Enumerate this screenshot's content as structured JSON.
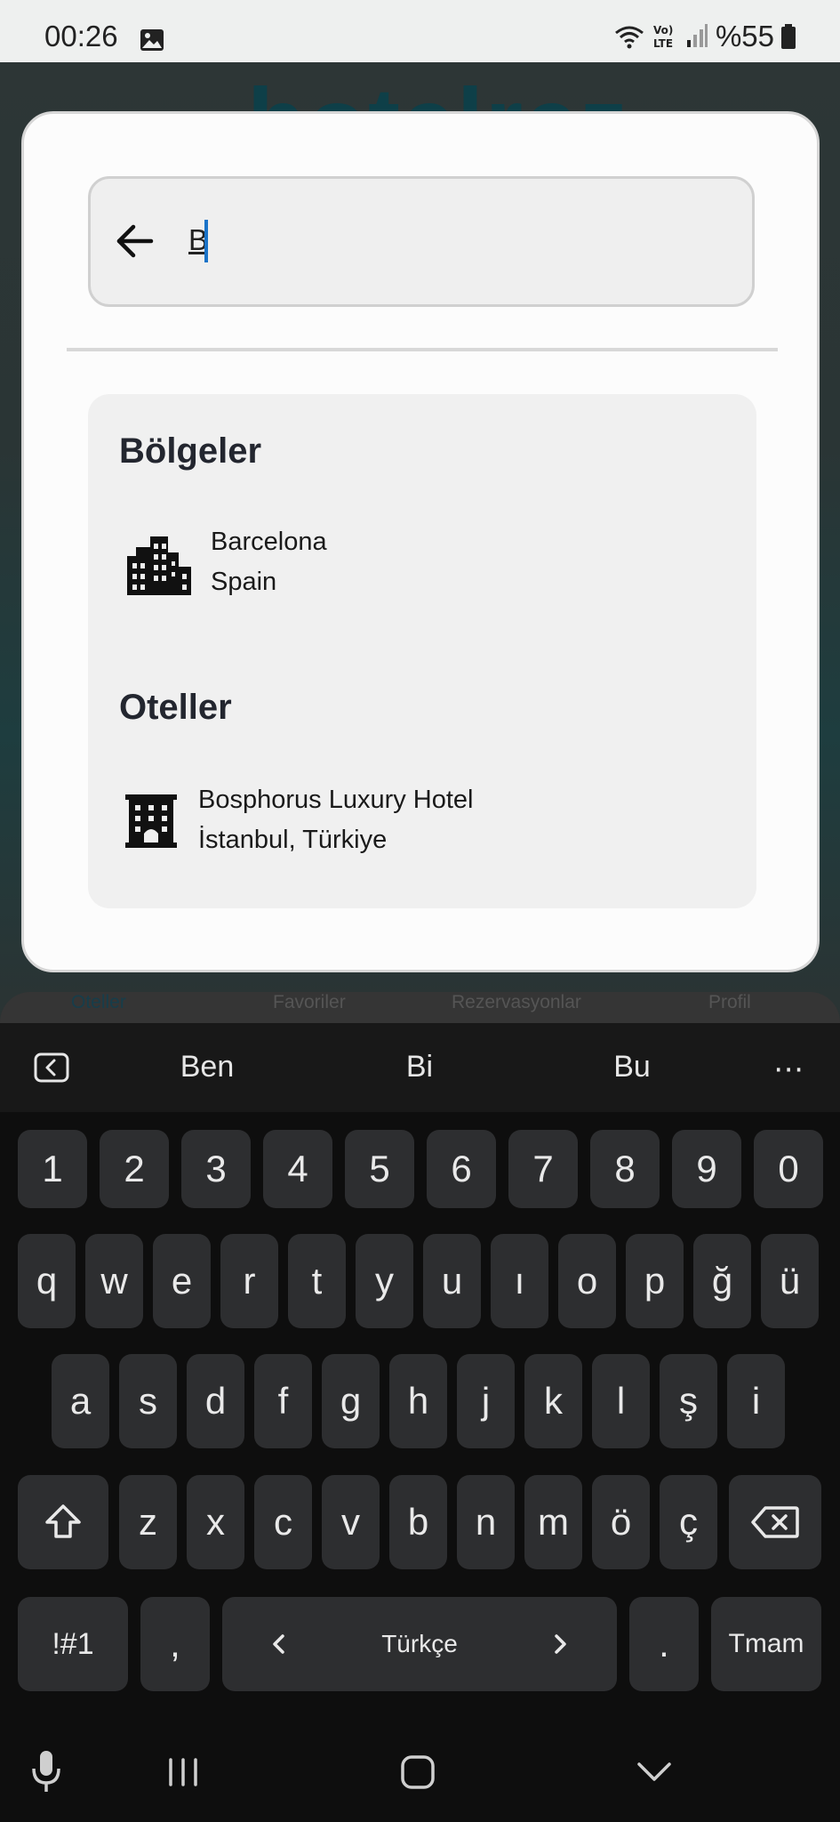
{
  "status_bar": {
    "time": "00:26",
    "battery": "%55",
    "icons": [
      "gallery-icon",
      "wifi-icon",
      "volte-icon",
      "signal-icon",
      "battery-icon"
    ]
  },
  "background_app": {
    "logo": "hotelrez",
    "nav": {
      "hotels": "Oteller",
      "favorites": "Favoriler",
      "reservations": "Rezervasyonlar",
      "profile": "Profil"
    }
  },
  "search": {
    "value": "B",
    "back_icon": "arrow-left-icon"
  },
  "results": {
    "regions_title": "Bölgeler",
    "regions": [
      {
        "name": "Barcelona",
        "country": "Spain",
        "icon": "city-icon"
      }
    ],
    "hotels_title": "Oteller",
    "hotels": [
      {
        "name": "Bosphorus Luxury Hotel",
        "location": "İstanbul, Türkiye",
        "icon": "hotel-building-icon"
      }
    ]
  },
  "keyboard": {
    "suggestions": [
      "Ben",
      "Bi",
      "Bu"
    ],
    "row_numbers": [
      "1",
      "2",
      "3",
      "4",
      "5",
      "6",
      "7",
      "8",
      "9",
      "0"
    ],
    "row1": [
      "q",
      "w",
      "e",
      "r",
      "t",
      "y",
      "u",
      "ı",
      "o",
      "p",
      "ğ",
      "ü"
    ],
    "row2": [
      "a",
      "s",
      "d",
      "f",
      "g",
      "h",
      "j",
      "k",
      "l",
      "ş",
      "i"
    ],
    "row3": [
      "z",
      "x",
      "c",
      "v",
      "b",
      "n",
      "m",
      "ö",
      "ç"
    ],
    "symbols_key": "!#1",
    "comma_key": ",",
    "space_label": "Türkçe",
    "period_key": ".",
    "done_key": "Tmam"
  },
  "colors": {
    "accent": "#1a73c8",
    "dialog_bg": "#fcfcfc",
    "results_bg": "#f0f0f0",
    "keyboard_bg": "#0e0e0e",
    "key_bg": "#2d2e30",
    "title_text": "#23262f"
  }
}
